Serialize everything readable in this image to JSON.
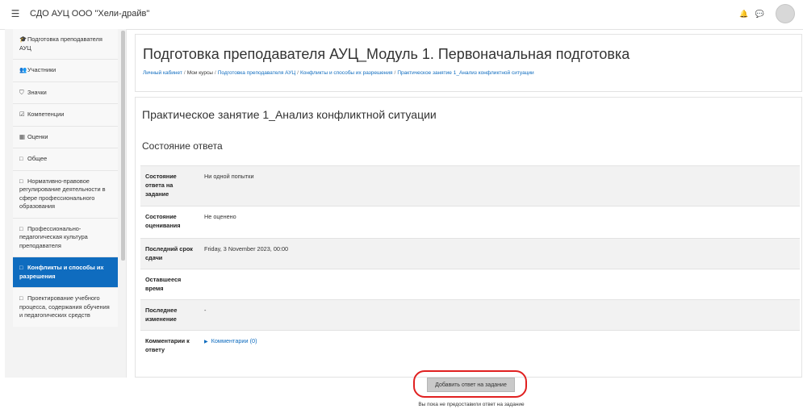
{
  "navbar": {
    "menu_icon": "hamburger-icon",
    "site_name": "СДО АУЦ ООО \"Хели-драйв\"",
    "icons": [
      "bell-icon",
      "chat-icon"
    ],
    "avatar": "user-avatar"
  },
  "sidebar": {
    "items": [
      {
        "icon": "graduation-cap-icon",
        "label": "Подготовка преподавателя АУЦ",
        "active": false
      },
      {
        "icon": "users-icon",
        "label": "Участники",
        "active": false
      },
      {
        "icon": "shield-icon",
        "label": "Значки",
        "active": false
      },
      {
        "icon": "checkbox-icon",
        "label": "Компетенции",
        "active": false
      },
      {
        "icon": "table-icon",
        "label": "Оценки",
        "active": false
      },
      {
        "icon": "folder-icon",
        "label": "Общее",
        "active": false
      },
      {
        "icon": "folder-icon",
        "label": "Нормативно-правовое регулирование деятельности в сфере профессионального образования",
        "active": false
      },
      {
        "icon": "folder-icon",
        "label": "Профессионально-педагогическая культура преподавателя",
        "active": false
      },
      {
        "icon": "folder-icon",
        "label": "Конфликты и способы их разрешения",
        "active": true
      },
      {
        "icon": "folder-icon",
        "label": "Проектирование учебного процесса, содержания обучения и педагогических средств",
        "active": false
      }
    ]
  },
  "header": {
    "title": "Подготовка преподавателя АУЦ_Модуль 1. Первоначальная подготовка",
    "breadcrumb": [
      {
        "label": "Личный кабинет",
        "link": true
      },
      {
        "label": "Мои курсы",
        "link": false
      },
      {
        "label": "Подготовка преподавателя АУЦ",
        "link": true
      },
      {
        "label": "Конфликты и способы их разрешения",
        "link": true
      },
      {
        "label": "Практическое занятие 1_Анализ конфликтной ситуации",
        "link": true
      }
    ]
  },
  "main": {
    "activity_title": "Практическое занятие 1_Анализ конфликтной ситуации",
    "section_title": "Состояние ответа",
    "rows": [
      {
        "label": "Состояние ответа на задание",
        "value": "Ни одной попытки"
      },
      {
        "label": "Состояние оценивания",
        "value": "Не оценено"
      },
      {
        "label": "Последний срок сдачи",
        "value": "Friday, 3 November 2023, 00:00"
      },
      {
        "label": "Оставшееся время",
        "value": ""
      },
      {
        "label": "Последнее изменение",
        "value": "-"
      },
      {
        "label": "Комментарии к ответу",
        "value": "Комментарии (0)"
      }
    ],
    "add_button_label": "Добавить ответ на задание",
    "note": "Вы пока не предоставили ответ на задание"
  }
}
